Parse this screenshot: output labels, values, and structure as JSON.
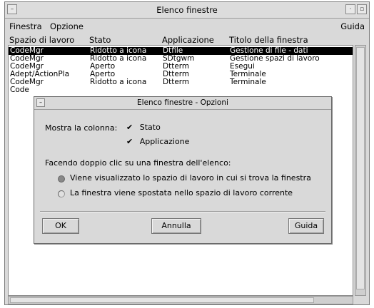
{
  "window": {
    "title": "Elenco finestre"
  },
  "menubar": {
    "finestra": "Finestra",
    "opzione": "Opzione",
    "guida": "Guida"
  },
  "columns": [
    "Spazio di lavoro",
    "Stato",
    "Applicazione",
    "Titolo della finestra"
  ],
  "rows": [
    {
      "workspace": "CodeMgr",
      "state": "Ridotto a icona",
      "app": "Dtfile",
      "title": "Gestione di file - dati",
      "selected": true
    },
    {
      "workspace": "CodeMgr",
      "state": "Ridotto a icona",
      "app": "SDtgwm",
      "title": "Gestione spazi di lavoro",
      "selected": false
    },
    {
      "workspace": "CodeMgr",
      "state": "Aperto",
      "app": "Dtterm",
      "title": "Esegui",
      "selected": false
    },
    {
      "workspace": "Adept/ActionPla",
      "state": "Aperto",
      "app": "Dtterm",
      "title": "Terminale",
      "selected": false
    },
    {
      "workspace": "CodeMgr",
      "state": "Ridotto a icona",
      "app": "Dtterm",
      "title": "Terminale",
      "selected": false
    },
    {
      "workspace": "Code",
      "state": "",
      "app": "",
      "title": "",
      "selected": false
    }
  ],
  "dialog": {
    "title": "Elenco finestre - Opzioni",
    "show_column_label": "Mostra la colonna:",
    "check_stato": "Stato",
    "check_applicazione": "Applicazione",
    "double_click_label": "Facendo doppio clic su una finestra dell'elenco:",
    "radio_1": "Viene visualizzato lo spazio di lavoro in cui si trova la finestra",
    "radio_2": "La finestra viene spostata nello spazio di lavoro corrente",
    "ok": "OK",
    "cancel": "Annulla",
    "help": "Guida"
  }
}
